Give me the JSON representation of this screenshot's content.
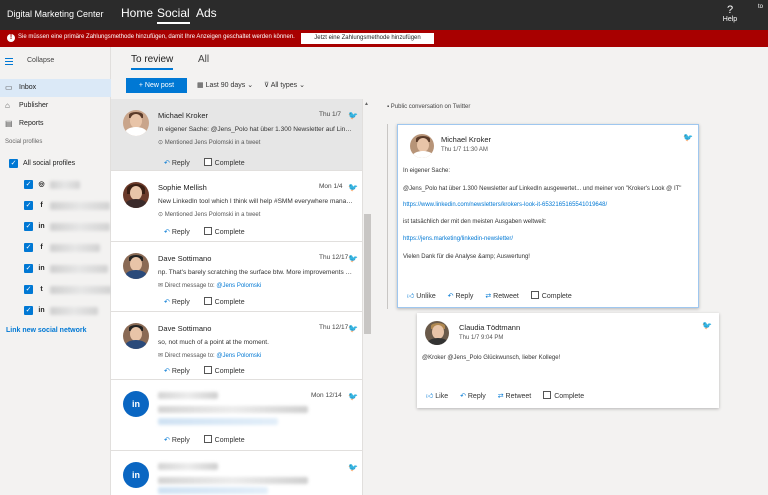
{
  "topbar": {
    "brand": "Digital Marketing Center",
    "nav": [
      "Home",
      "Social",
      "Ads"
    ],
    "help_label": "Help",
    "edge_text": "to"
  },
  "banner": {
    "message": "Sie müssen eine primäre Zahlungsmethode hinzufügen, damit Ihre Anzeigen geschaltet werden können.",
    "button_label": "Jetzt eine Zahlungsmethode hinzufügen"
  },
  "sidebar": {
    "collapse_label": "Collapse",
    "items": [
      {
        "label": "Inbox",
        "icon": "inbox-icon"
      },
      {
        "label": "Publisher",
        "icon": "publisher-icon"
      },
      {
        "label": "Reports",
        "icon": "reports-icon"
      }
    ],
    "profiles_heading": "Social profiles",
    "all_profiles_label": "All social profiles",
    "profiles": [
      {
        "network": "instagram"
      },
      {
        "network": "facebook"
      },
      {
        "network": "linkedin"
      },
      {
        "network": "facebook"
      },
      {
        "network": "linkedin"
      },
      {
        "network": "twitter"
      },
      {
        "network": "linkedin"
      }
    ],
    "link_new": "Link new social network"
  },
  "review": {
    "tabs": [
      "To review",
      "All"
    ],
    "new_post_label": "+ New post",
    "date_filter": "Last 90 days",
    "type_filter": "All types"
  },
  "feed": [
    {
      "name": "Michael Kroker",
      "date": "Thu 1/7",
      "text": "In eigener Sache: @Jens_Polo hat über 1.300 Newsletter auf LinkedIn a...",
      "meta_prefix": "Mentioned Jens Polomski in a tweet",
      "meta_mention": "",
      "reply_label": "Reply",
      "complete_label": "Complete"
    },
    {
      "name": "Sophie Mellish",
      "date": "Mon 1/4",
      "text": "New LinkedIn tool which I think will help #SMM everywhere managing...",
      "meta_prefix": "Mentioned Jens Polomski in a tweet",
      "meta_mention": "",
      "reply_label": "Reply",
      "complete_label": "Complete"
    },
    {
      "name": "Dave Sottimano",
      "date": "Thu 12/17",
      "text": "np. That's barely scratching the surface btw. More improvements comi...",
      "meta_prefix": "Direct message to:",
      "meta_mention": "@Jens Polomski",
      "reply_label": "Reply",
      "complete_label": "Complete"
    },
    {
      "name": "Dave Sottimano",
      "date": "Thu 12/17",
      "text": "so, not much of a point at the moment.",
      "meta_prefix": "Direct message to:",
      "meta_mention": "@Jens Polomski",
      "reply_label": "Reply",
      "complete_label": "Complete"
    },
    {
      "date": "Mon 12/14",
      "reply_label": "Reply",
      "complete_label": "Complete"
    },
    {
      "date": "",
      "reply_label": "",
      "complete_label": ""
    }
  ],
  "conversation": {
    "heading": "Public conversation on Twitter",
    "main_post": {
      "name": "Michael Kroker",
      "date": "Thu 1/7 11:30 AM",
      "lines": [
        "In eigener Sache:",
        "@Jens_Polo hat über 1.300 Newsletter auf LinkedIn ausgewertet... und meiner von \"Kroker's Look @ IT\"",
        "https://www.linkedin.com/newsletters/krokers-look-it-6532165165541019648/",
        "ist tatsächlich der mit den meisten Ausgaben weltweit:",
        "https://jens.marketing/linkedin-newsletter/",
        "Vielen Dank für die Analyse &amp; Auswertung!"
      ],
      "actions": [
        "Unlike",
        "Reply",
        "Retweet",
        "Complete"
      ]
    },
    "reply_post": {
      "name": "Claudia Tödtmann",
      "date": "Thu 1/7 9:04 PM",
      "text": "@Kroker @Jens_Polo Glückwunsch, lieber Kollege!",
      "actions": [
        "Like",
        "Reply",
        "Retweet",
        "Complete"
      ]
    }
  },
  "colors": {
    "accent": "#0078d4",
    "banner": "#a80000",
    "topbar": "#2b2b2b",
    "twitter": "#1da1f2"
  }
}
